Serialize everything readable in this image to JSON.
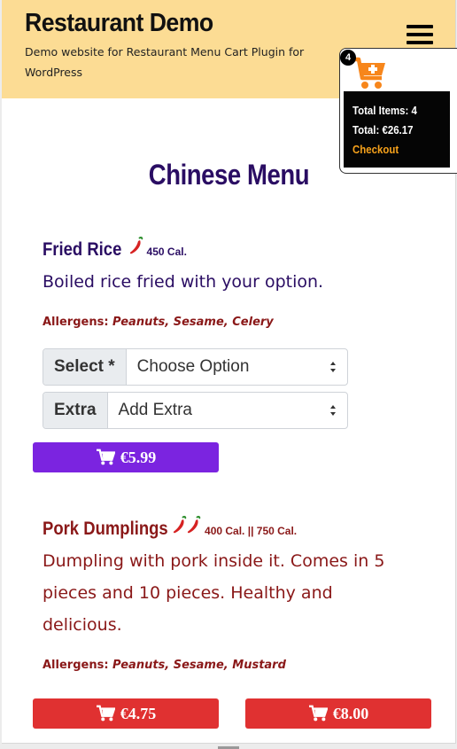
{
  "header": {
    "site_title": "Restaurant Demo",
    "site_description": "Demo website for Restaurant Menu Cart Plugin for WordPress",
    "menu_icon": "hamburger-icon",
    "background": "#fcdc94"
  },
  "cart": {
    "count": "4",
    "icon": "cart-plus-icon",
    "total_items": "Total Items: 4",
    "total": "Total: €26.17",
    "checkout": "Checkout",
    "icon_color": "#f7861b",
    "checkout_color": "#f7a21b"
  },
  "menu": {
    "heading": "Chinese Menu",
    "heading_color": "#2a0d63"
  },
  "items": [
    {
      "name": "Fried Rice",
      "spice_icons": [
        "chili-icon"
      ],
      "calories": "450 Cal.",
      "description": "Boiled rice fried with your option.",
      "allergens_label": "Allergens:",
      "allergens": "Peanuts, Sesame, Celery",
      "select_label": "Select *",
      "select_value": "Choose Option",
      "extra_label": "Extra",
      "extra_value": "Add Extra",
      "buttons": [
        "€5.99"
      ],
      "color": "#2a0d63",
      "button_color": "#7b24e0"
    },
    {
      "name": "Pork Dumplings",
      "spice_icons": [
        "chili-icon",
        "chili-icon"
      ],
      "calories": "400 Cal. || 750 Cal.",
      "description": "Dumpling with pork inside it. Comes in 5 pieces and 10 pieces. Healthy and delicious.",
      "allergens_label": "Allergens:",
      "allergens": "Peanuts, Sesame, Mustard",
      "buttons": [
        "€4.75",
        "€8.00"
      ],
      "color": "#8a1818",
      "button_color": "#e03131"
    }
  ]
}
